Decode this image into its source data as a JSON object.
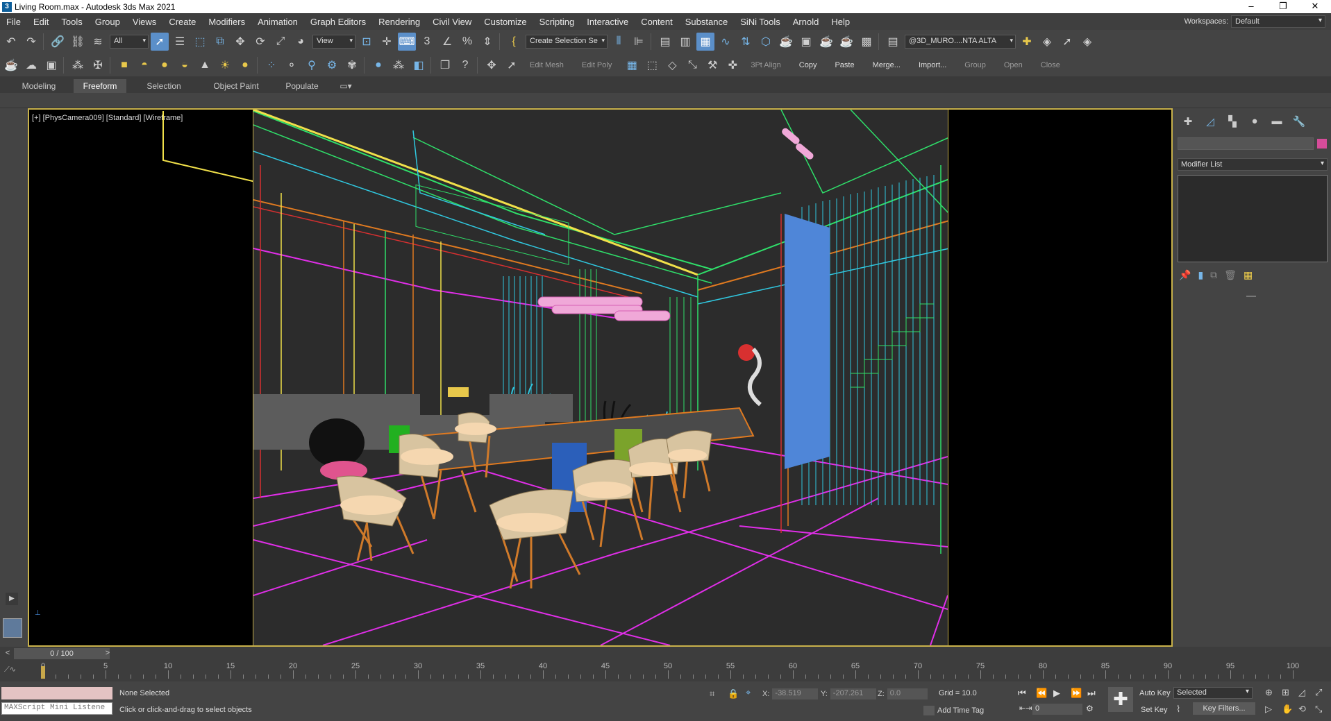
{
  "window": {
    "title": "Living Room.max - Autodesk 3ds Max 2021",
    "app_icon": "3"
  },
  "menubar": {
    "items": [
      "File",
      "Edit",
      "Tools",
      "Group",
      "Views",
      "Create",
      "Modifiers",
      "Animation",
      "Graph Editors",
      "Rendering",
      "Civil View",
      "Customize",
      "Scripting",
      "Interactive",
      "Content",
      "Substance",
      "SiNi Tools",
      "Arnold",
      "Help"
    ],
    "workspace_label": "Workspaces:",
    "workspace_value": "Default"
  },
  "toolbar1": {
    "selection_filter": "All",
    "ref_coord": "View",
    "named_selection": "Create Selection Se",
    "layer": "@3D_MURO....NTA ALTA"
  },
  "toolbar2": {
    "edit_mesh": "Edit Mesh",
    "edit_poly": "Edit Poly",
    "align_3pt": "3Pt Align",
    "copy": "Copy",
    "paste": "Paste",
    "merge": "Merge...",
    "import": "Import...",
    "group": "Group",
    "open": "Open",
    "close": "Close"
  },
  "ribbon": {
    "tabs": [
      "Modeling",
      "Freeform",
      "Selection",
      "Object Paint",
      "Populate"
    ],
    "active_tab": "Freeform"
  },
  "viewport": {
    "label": "[+] [PhysCamera009] [Standard] [Wireframe]"
  },
  "command_panel": {
    "modifier_list": "Modifier List",
    "object_color": "#d64c9a"
  },
  "timeline": {
    "frame_counter": "0 / 100",
    "ticks": [
      0,
      5,
      10,
      15,
      20,
      25,
      30,
      35,
      40,
      45,
      50,
      55,
      60,
      65,
      70,
      75,
      80,
      85,
      90,
      95,
      100
    ]
  },
  "status": {
    "maxscript_placeholder": "MAXScript Mini Listene",
    "selection": "None Selected",
    "prompt": "Click or click-and-drag to select objects",
    "x_label": "X:",
    "x_value": "-38.519",
    "y_label": "Y:",
    "y_value": "-207.261",
    "z_label": "Z:",
    "z_value": "0.0",
    "grid": "Grid = 10.0",
    "add_time_tag": "Add Time Tag",
    "current_frame": "0",
    "auto_key": "Auto Key",
    "set_key": "Set Key",
    "key_mode": "Selected",
    "key_filters": "Key Filters..."
  },
  "colors": {
    "accent_active": "#5b8fc9",
    "viewport_border": "#c9b24b",
    "wire_magenta": "#e02ee8",
    "wire_green": "#2fe06a",
    "wire_yellow": "#f0e04a",
    "wire_cyan": "#30c8e0",
    "wire_orange": "#e07a20",
    "wire_red": "#d83030",
    "panel_blue": "#4f86d8",
    "chair_beige": "#f5d7b0"
  }
}
